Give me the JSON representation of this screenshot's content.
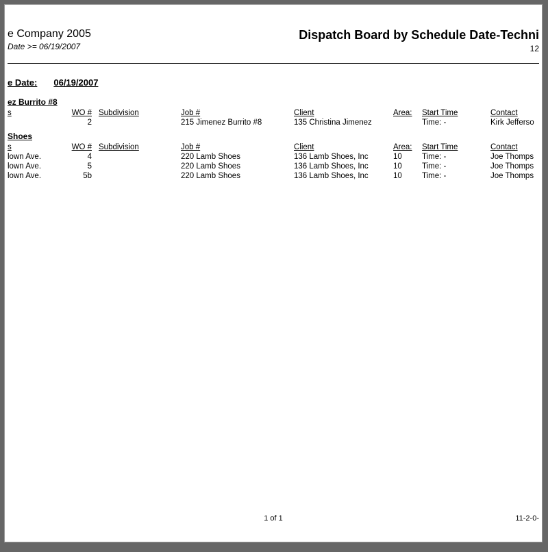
{
  "header": {
    "company": "e Company 2005",
    "filter": "Date >= 06/19/2007",
    "title": "Dispatch Board by Schedule Date-Techni",
    "subnum": "12"
  },
  "schedule": {
    "label": "e Date:",
    "value": "06/19/2007"
  },
  "columns": {
    "address": "s",
    "wo": "WO #",
    "subdivision": "Subdivision",
    "job": "Job #",
    "client": "Client",
    "area": "Area:",
    "start": "Start Time",
    "contact": "Contact"
  },
  "groups": [
    {
      "title": "ez Burrito #8",
      "rows": [
        {
          "address": "",
          "wo": "2",
          "subdivision": "",
          "job": "215 Jimenez Burrito #8",
          "client": "135 Christina Jimenez",
          "area": "",
          "start": "Time:  -",
          "contact": "Kirk Jefferso"
        }
      ]
    },
    {
      "title": "Shoes",
      "rows": [
        {
          "address": "lown Ave.",
          "wo": "4",
          "subdivision": "",
          "job": "220 Lamb Shoes",
          "client": "136 Lamb Shoes, Inc",
          "area": "10",
          "start": "Time:  -",
          "contact": "Joe Thomps"
        },
        {
          "address": "lown Ave.",
          "wo": "5",
          "subdivision": "",
          "job": "220 Lamb Shoes",
          "client": "136 Lamb Shoes, Inc",
          "area": "10",
          "start": "Time:  -",
          "contact": "Joe Thomps"
        },
        {
          "address": "lown Ave.",
          "wo": "5b",
          "subdivision": "",
          "job": "220 Lamb Shoes",
          "client": "136 Lamb Shoes, Inc",
          "area": "10",
          "start": "Time:  -",
          "contact": "Joe Thomps"
        }
      ]
    }
  ],
  "footer": {
    "page": "1 of 1",
    "build": "11-2-0-"
  }
}
